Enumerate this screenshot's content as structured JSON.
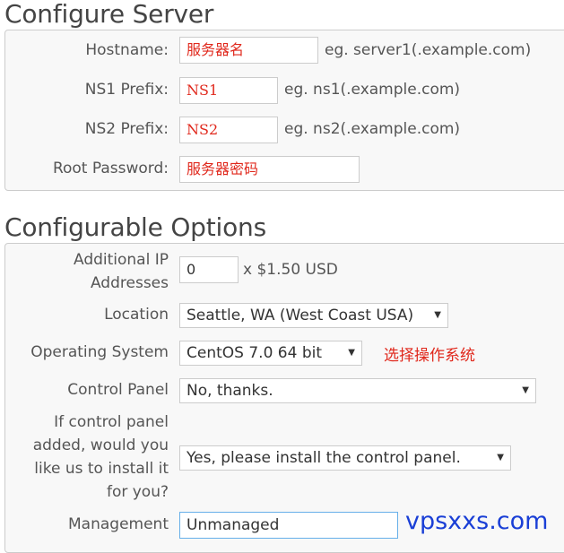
{
  "server": {
    "title": "Configure Server",
    "hostname": {
      "label": "Hostname:",
      "value": "服务器名",
      "hint": "eg. server1(.example.com)"
    },
    "ns1": {
      "label": "NS1 Prefix:",
      "value": "NS1",
      "hint": "eg. ns1(.example.com)"
    },
    "ns2": {
      "label": "NS2 Prefix:",
      "value": "NS2",
      "hint": "eg. ns2(.example.com)"
    },
    "root_password": {
      "label": "Root Password:",
      "value": "服务器密码"
    }
  },
  "options": {
    "title": "Configurable Options",
    "additional_ip": {
      "label": "Additional IP Addresses",
      "value": "0",
      "suffix": "x $1.50 USD"
    },
    "location": {
      "label": "Location",
      "selected": "Seattle, WA (West Coast USA)"
    },
    "os": {
      "label": "Operating System",
      "selected": "CentOS 7.0 64 bit",
      "annotation": "选择操作系统"
    },
    "control_panel": {
      "label": "Control Panel",
      "selected": "No, thanks."
    },
    "install": {
      "label": "If control panel added, would you like us to install it for you?",
      "selected": "Yes, please install the control panel."
    },
    "management": {
      "label": "Management",
      "value": "Unmanaged"
    }
  },
  "watermark": "vpsxxs.com",
  "icons": {
    "dropdown": "▼"
  },
  "colors": {
    "annotation": "#e0281c",
    "watermark": "#1a3fd6",
    "panel_bg": "#f8f8f8",
    "border": "#cccccc"
  }
}
